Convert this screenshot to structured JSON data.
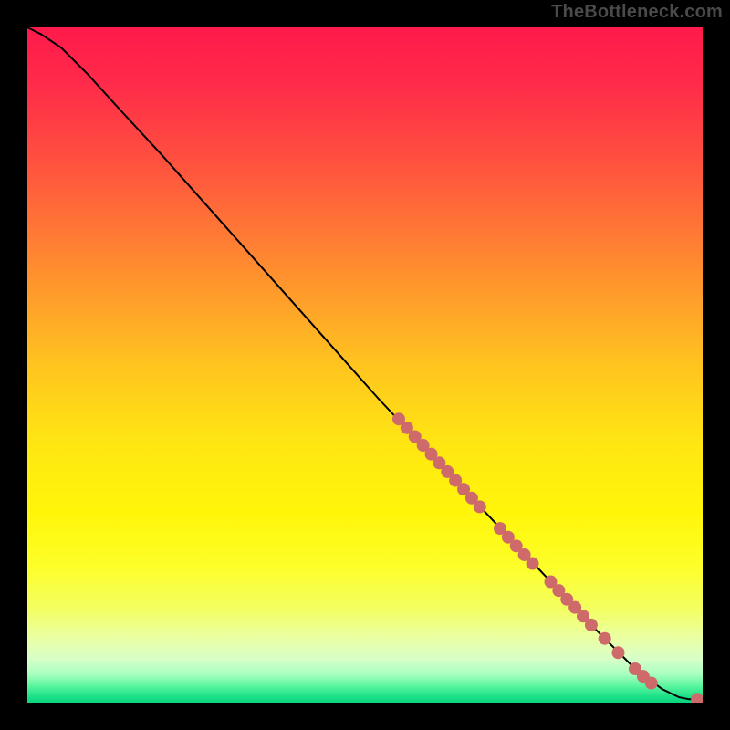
{
  "watermark": "TheBottleneck.com",
  "chart_data": {
    "type": "line",
    "title": "",
    "xlabel": "",
    "ylabel": "",
    "xlim": [
      0,
      100
    ],
    "ylim": [
      0,
      100
    ],
    "grid": false,
    "curve": [
      {
        "x": 0,
        "y": 100
      },
      {
        "x": 2,
        "y": 99
      },
      {
        "x": 5,
        "y": 97
      },
      {
        "x": 9,
        "y": 93
      },
      {
        "x": 14,
        "y": 87.5
      },
      {
        "x": 20,
        "y": 81
      },
      {
        "x": 28,
        "y": 72
      },
      {
        "x": 36,
        "y": 63
      },
      {
        "x": 44,
        "y": 54
      },
      {
        "x": 52,
        "y": 45
      },
      {
        "x": 60,
        "y": 36.5
      },
      {
        "x": 68,
        "y": 28
      },
      {
        "x": 76,
        "y": 19.5
      },
      {
        "x": 84,
        "y": 11
      },
      {
        "x": 90,
        "y": 5
      },
      {
        "x": 94,
        "y": 2
      },
      {
        "x": 96.5,
        "y": 0.8
      },
      {
        "x": 98,
        "y": 0.5
      },
      {
        "x": 100,
        "y": 0.5
      }
    ],
    "markers": [
      {
        "x": 55.0,
        "y": 42.0
      },
      {
        "x": 56.2,
        "y": 40.7
      },
      {
        "x": 57.4,
        "y": 39.4
      },
      {
        "x": 58.6,
        "y": 38.1
      },
      {
        "x": 59.8,
        "y": 36.8
      },
      {
        "x": 61.0,
        "y": 35.5
      },
      {
        "x": 62.2,
        "y": 34.2
      },
      {
        "x": 63.4,
        "y": 32.9
      },
      {
        "x": 64.6,
        "y": 31.6
      },
      {
        "x": 65.8,
        "y": 30.3
      },
      {
        "x": 67.0,
        "y": 29.0
      },
      {
        "x": 70.0,
        "y": 25.8
      },
      {
        "x": 71.2,
        "y": 24.5
      },
      {
        "x": 72.4,
        "y": 23.2
      },
      {
        "x": 73.6,
        "y": 21.9
      },
      {
        "x": 74.8,
        "y": 20.6
      },
      {
        "x": 77.5,
        "y": 17.9
      },
      {
        "x": 78.7,
        "y": 16.6
      },
      {
        "x": 79.9,
        "y": 15.3
      },
      {
        "x": 81.1,
        "y": 14.1
      },
      {
        "x": 82.3,
        "y": 12.8
      },
      {
        "x": 83.5,
        "y": 11.5
      },
      {
        "x": 85.5,
        "y": 9.5
      },
      {
        "x": 87.5,
        "y": 7.4
      },
      {
        "x": 90.0,
        "y": 5.0
      },
      {
        "x": 91.2,
        "y": 3.9
      },
      {
        "x": 92.4,
        "y": 2.9
      },
      {
        "x": 99.2,
        "y": 0.5
      }
    ],
    "gradient_stops": [
      {
        "offset": 0.0,
        "color": "#ff1a4b"
      },
      {
        "offset": 0.08,
        "color": "#ff2a4a"
      },
      {
        "offset": 0.2,
        "color": "#ff513f"
      },
      {
        "offset": 0.35,
        "color": "#ff8a30"
      },
      {
        "offset": 0.5,
        "color": "#ffc41f"
      },
      {
        "offset": 0.62,
        "color": "#ffe712"
      },
      {
        "offset": 0.72,
        "color": "#fff60a"
      },
      {
        "offset": 0.8,
        "color": "#fdff2a"
      },
      {
        "offset": 0.86,
        "color": "#f3ff60"
      },
      {
        "offset": 0.905,
        "color": "#eaffa5"
      },
      {
        "offset": 0.935,
        "color": "#d8ffc8"
      },
      {
        "offset": 0.958,
        "color": "#a8ffc0"
      },
      {
        "offset": 0.975,
        "color": "#5cf5a0"
      },
      {
        "offset": 0.992,
        "color": "#18e088"
      },
      {
        "offset": 1.0,
        "color": "#0bd47c"
      }
    ],
    "marker_color": "#cf6a6a",
    "line_color": "#000000"
  }
}
